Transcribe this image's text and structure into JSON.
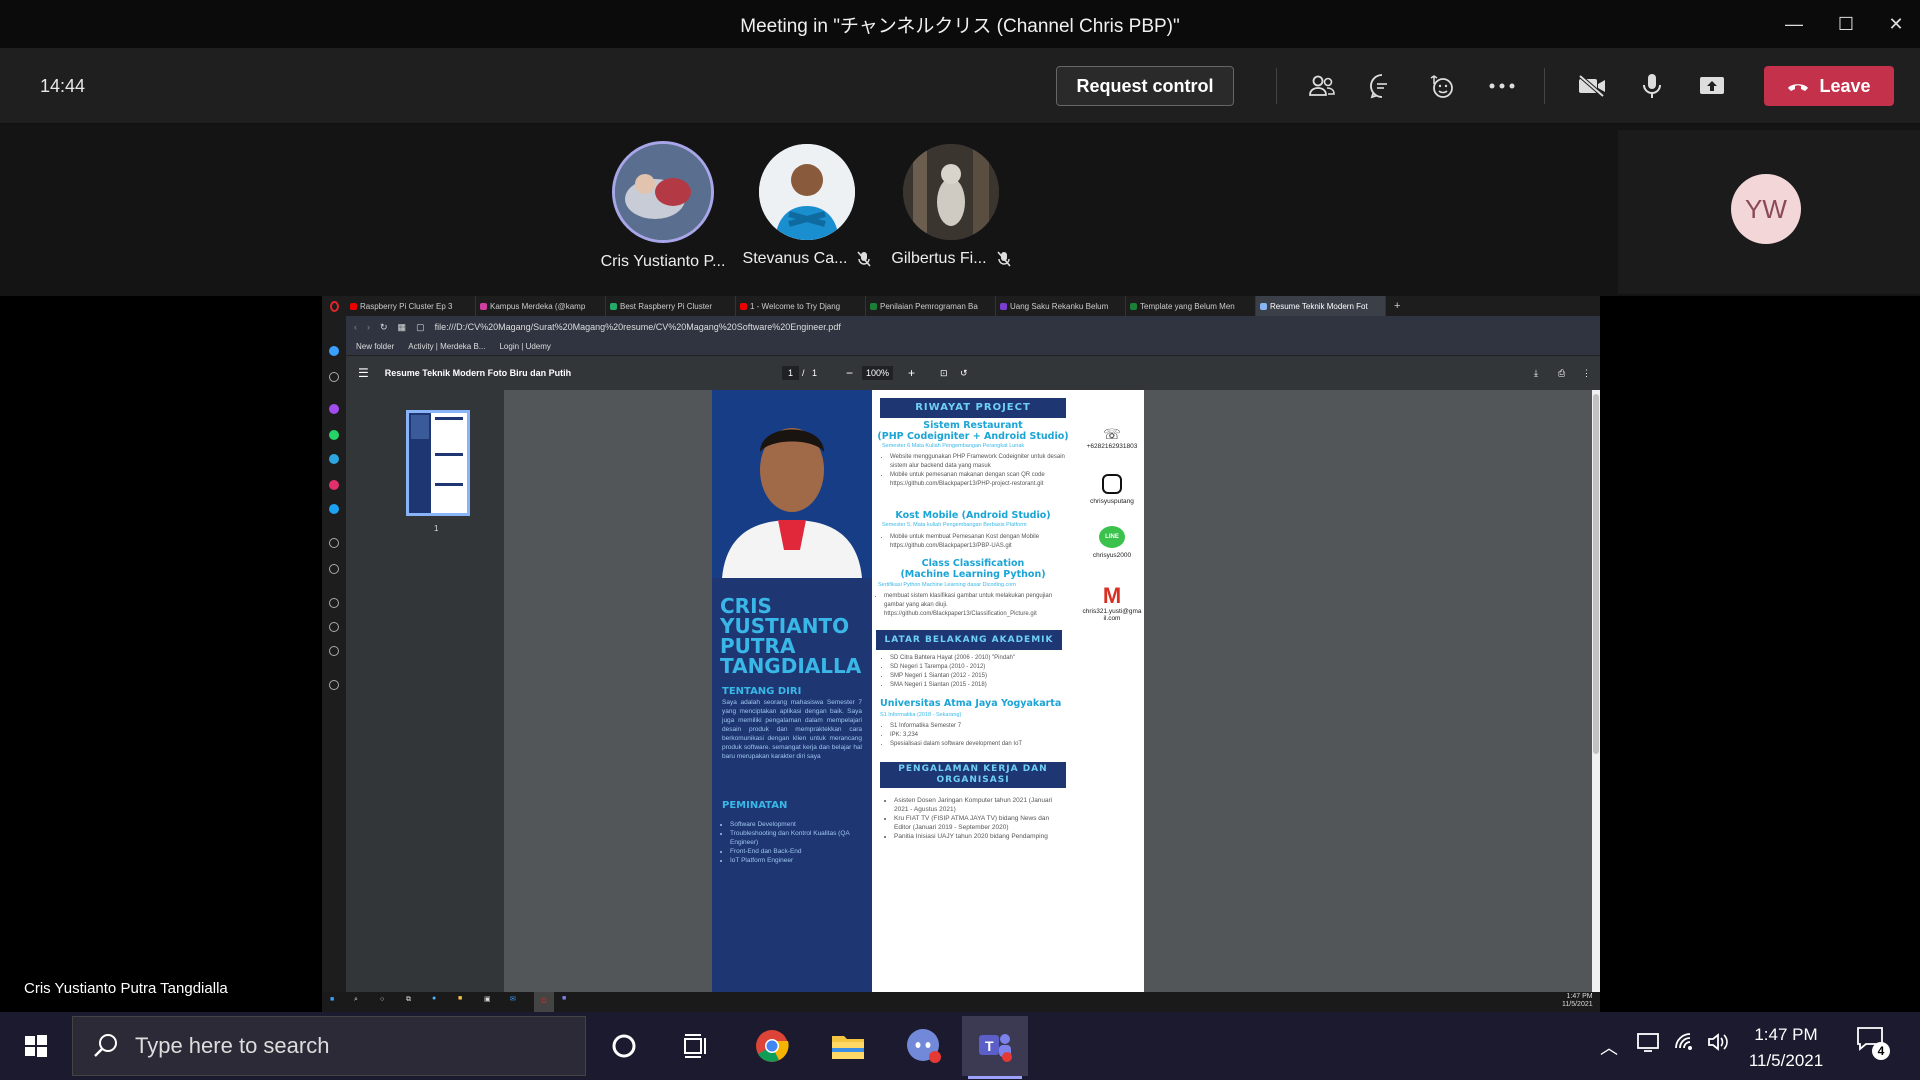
{
  "window": {
    "title": "Meeting in \"チャンネルクリス (Channel Chris PBP)\""
  },
  "toolbar": {
    "clock": "14:44",
    "request_control": "Request control",
    "leave": "Leave"
  },
  "participants": [
    {
      "name": "Cris Yustianto P..."
    },
    {
      "name": "Stevanus Ca..."
    },
    {
      "name": "Gilbertus Fi..."
    }
  ],
  "self_avatar": {
    "initials": "YW"
  },
  "presenter_name": "Cris Yustianto Putra Tangdialla",
  "browser": {
    "tabs": [
      "Raspberry Pi Cluster Ep 3",
      "Kampus Merdeka (@kamp",
      "Best Raspberry Pi Cluster",
      "1 - Welcome to Try Djang",
      "Penilaian Pemrograman Ba",
      "Uang Saku Rekanku Belum",
      "Template yang Belum Men",
      "Resume Teknik Modern Fot"
    ],
    "url": "file:///D:/CV%20Magang/Surat%20Magang%20resume/CV%20Magang%20Software%20Engineer.pdf",
    "bookmarks": [
      "New folder",
      "Activity | Merdeka B...",
      "Login | Udemy"
    ],
    "pdf_title": "Resume Teknik Modern Foto Biru dan Putih",
    "page_num": "1",
    "page_total": "1",
    "zoom": "100%",
    "thumb_label": "1",
    "inner_time": "1:47 PM",
    "inner_date": "11/5/2021"
  },
  "resume": {
    "name": "CRIS YUSTIANTO PUTRA TANGDIALLA",
    "about_title": "TENTANG DIRI",
    "about_text": "Saya adalah seorang mahasiswa Semester 7 yang menciptakan aplikasi dengan baik. Saya juga memiliki pengalaman dalam mempelajari desain produk dan mempraktekkan cara berkomunikasi dengan klien untuk merancang produk software. semangat kerja dan belajar hal baru merupakan karakter diri saya",
    "interest_title": "PEMINATAN",
    "interests": [
      "Software Development",
      "Troubleshooting dan Kontrol Kualitas (QA Engineer)",
      "Front-End dan Back-End",
      "IoT Platform Engineer"
    ],
    "project_title": "RIWAYAT PROJECT",
    "projects": [
      {
        "title": "Sistem Restaurant",
        "subtitle": "(PHP Codeigniter + Android Studio)",
        "note": "Semester 6 Mata Kuliah Pengembangan Perangkat Lunak",
        "items": [
          "Website menggunakan PHP Framework Codeigniter untuk desain sistem alur backend data yang masuk",
          "Mobile untuk pemesanan makanan dengan scan QR code https://github.com/Blackpaper13/PHP-project-restorant.git"
        ]
      },
      {
        "title": "Kost Mobile (Android Studio)",
        "subtitle": "",
        "note": "Semester 5, Mata kuliah Pengembangan Berbasis Platform",
        "items": [
          "Mobile untuk membuat Pemesanan Kost dengan Mobile https://github.com/Blackpaper13/PBP-UAS.git"
        ]
      },
      {
        "title": "Class Classification",
        "subtitle": "(Machine Learning Python)",
        "note": "Sertifikasi Python Machine Learning dasar Dicoding.com",
        "items": [
          "membuat sistem klasifikasi gambar untuk melakukan pengujian gambar yang akan diuji. https://github.com/Blackpaper13/Classification_Picture.git"
        ]
      }
    ],
    "edu_title": "LATAR BELAKANG AKADEMIK",
    "edu_items": [
      "SD Citra Bahtera Hayat (2006 - 2010) \"Pindah\"",
      "SD Negeri 1 Tarempa (2010 - 2012)",
      "SMP Negeri 1 Siantan (2012 - 2015)",
      "SMA Negeri 1 Siantan (2015 - 2018)"
    ],
    "uni_title": "Universitas Atma Jaya Yogyakarta",
    "uni_note": "S1 Informatika (2018 - Sekarang)",
    "uni_items": [
      "S1 Informatika Semester 7",
      "IPK: 3,234",
      "Spesialisasi dalam software development dan IoT"
    ],
    "work_title": "PENGALAMAN KERJA DAN ORGANISASI",
    "work_items": [
      "Asisten Dosen Jaringan Komputer tahun 2021 (Januari 2021 - Agustus 2021)",
      "Kru FIAT TV (FISIP ATMA JAYA TV) bidang News dan Editor (Januari 2019 - September 2020)",
      "Panitia Inisiasi UAJY tahun 2020 bidang Pendamping"
    ],
    "contacts": [
      "+6282162931803",
      "chrisyusputang",
      "chrisyus2000",
      "chris321.yusti@gmail.com"
    ]
  },
  "taskbar": {
    "search_placeholder": "Type here to search",
    "time": "1:47 PM",
    "date": "11/5/2021",
    "notif_count": "4"
  },
  "colors": {
    "leave": "#c4314b",
    "resume_navy": "#1e3773",
    "resume_cyan": "#39b8e8"
  }
}
